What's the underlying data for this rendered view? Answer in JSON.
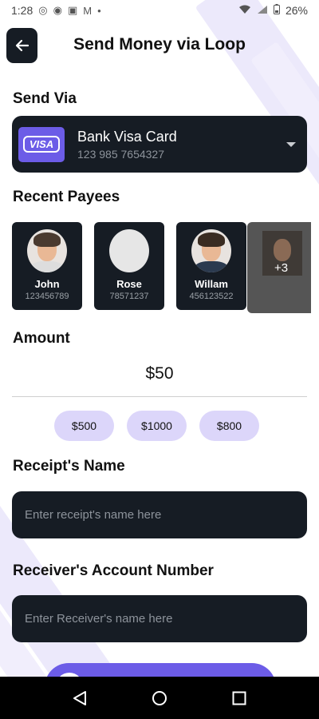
{
  "status_bar": {
    "time": "1:28",
    "battery": "26%"
  },
  "header": {
    "title": "Send Money via Loop"
  },
  "send_via": {
    "label": "Send Via",
    "card_brand": "VISA",
    "card_name": "Bank Visa Card",
    "card_number": "123 985 7654327"
  },
  "recent_payees": {
    "label": "Recent Payees",
    "items": [
      {
        "name": "John",
        "account": "123456789"
      },
      {
        "name": "Rose",
        "account": "78571237"
      },
      {
        "name": "Willam",
        "account": "456123522"
      }
    ],
    "more_count": "+3"
  },
  "amount": {
    "label": "Amount",
    "value": "$50",
    "quick_options": [
      "$500",
      "$1000",
      "$800"
    ]
  },
  "receipt_name": {
    "label": "Receipt's Name",
    "placeholder": "Enter receipt's name here"
  },
  "receiver_account": {
    "label": "Receiver's Account Number",
    "placeholder": "Enter Receiver's name here"
  },
  "colors": {
    "accent": "#6c5ce7",
    "dark_card": "#161c24",
    "chip": "#dcd6fa"
  }
}
